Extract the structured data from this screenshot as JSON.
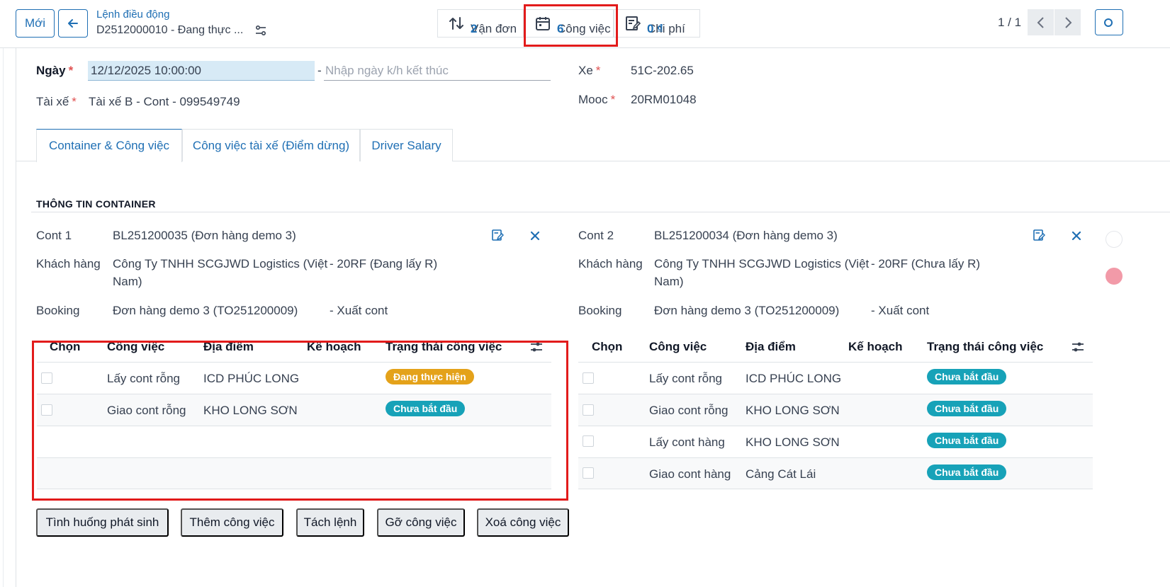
{
  "toolbar": {
    "new_label": "Mới",
    "breadcrumb_parent": "Lệnh điều động",
    "breadcrumb_record": "D2512000010 - Đang thực ..."
  },
  "stat_buttons": {
    "van_don": {
      "label": "Vận đơn",
      "value": "2"
    },
    "cong_viec": {
      "label": "Công việc",
      "value": "6"
    },
    "chi_phi": {
      "label": "Chi phí",
      "value": "0 ₫"
    }
  },
  "pager": {
    "value": "1 / 1"
  },
  "form": {
    "ngay_label": "Ngày",
    "ngay_value": "12/12/2025 10:00:00",
    "date_separator": "-",
    "end_date_placeholder": "Nhập ngày k/h kết thúc",
    "tai_xe_label": "Tài xế",
    "tai_xe_value": "Tài xế B - Cont - 099549749",
    "xe_label": "Xe",
    "xe_value": "51C-202.65",
    "mooc_label": "Mooc",
    "mooc_value": "20RM01048",
    "required_mark": "*"
  },
  "tabs": [
    {
      "label": "Container & Công việc"
    },
    {
      "label": "Công việc tài xế (Điểm dừng)"
    },
    {
      "label": "Driver Salary"
    }
  ],
  "section_title": "THÔNG TIN CONTAINER",
  "containers": [
    {
      "cont_label": "Cont 1",
      "cont_value": "BL251200035 (Đơn hàng demo 3)",
      "kh_label": "Khách hàng",
      "kh_line1": "Công Ty TNHH SCGJWD Logistics (Việt",
      "kh_line2": "Nam)",
      "kh_extra": "20RF (Đang lấy R)",
      "booking_label": "Booking",
      "booking_value": "Đơn hàng demo 3 (TO251200009)",
      "booking_extra": "Xuất cont",
      "extra_sep": "-",
      "headers": [
        "Chọn",
        "Công việc",
        "Địa điểm",
        "Kế hoạch",
        "Trạng thái công việc"
      ],
      "rows": [
        {
          "task": "Lấy cont rỗng",
          "place": "ICD PHÚC LONG",
          "status": "Đang thực hiện"
        },
        {
          "task": "Giao cont rỗng",
          "place": "KHO LONG SƠN",
          "status": "Chưa bắt đầu"
        }
      ]
    },
    {
      "cont_label": "Cont 2",
      "cont_value": "BL251200034 (Đơn hàng demo 3)",
      "kh_label": "Khách hàng",
      "kh_line1": "Công Ty TNHH SCGJWD Logistics (Việt",
      "kh_line2": "Nam)",
      "kh_extra": "20RF (Chưa lấy R)",
      "booking_label": "Booking",
      "booking_value": "Đơn hàng demo 3 (TO251200009)",
      "booking_extra": "Xuất cont",
      "extra_sep": "-",
      "headers": [
        "Chọn",
        "Công việc",
        "Địa điểm",
        "Kế hoạch",
        "Trạng thái công việc"
      ],
      "rows": [
        {
          "task": "Lấy cont rỗng",
          "place": "ICD PHÚC LONG",
          "status": "Chưa bắt đầu"
        },
        {
          "task": "Giao cont rỗng",
          "place": "KHO LONG SƠN",
          "status": "Chưa bắt đầu"
        },
        {
          "task": "Lấy cont hàng",
          "place": "KHO LONG SƠN",
          "status": "Chưa bắt đầu"
        },
        {
          "task": "Giao cont hàng",
          "place": "Cảng Cát Lái",
          "status": "Chưa bắt đầu"
        }
      ]
    }
  ],
  "actions": [
    {
      "label": "Tình huống phát sinh"
    },
    {
      "label": "Thêm công việc"
    },
    {
      "label": "Tách lệnh"
    },
    {
      "label": "Gỡ công việc"
    },
    {
      "label": "Xoá công việc"
    }
  ],
  "colors": {
    "primary": "#1f6fb4",
    "highlight": "#e21b1b",
    "status_in_progress": "#e4a21a",
    "status_not_started": "#17a2b8"
  }
}
